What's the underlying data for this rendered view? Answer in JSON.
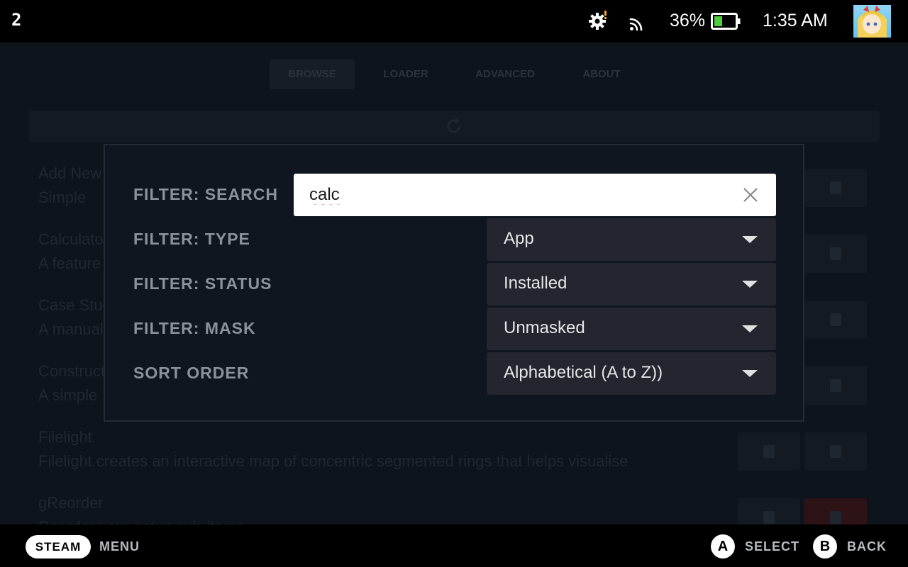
{
  "status_bar": {
    "left_indicator": "2",
    "battery_percent": "36%",
    "time": "1:35 AM",
    "icons": [
      "settings-alert-icon",
      "cast-icon",
      "battery-icon",
      "avatar"
    ]
  },
  "background": {
    "tabs": [
      "BROWSE",
      "LOADER",
      "ADVANCED",
      "ABOUT"
    ],
    "rows": [
      {
        "title": "Add New",
        "desc": "Simple"
      },
      {
        "title": "Calculator",
        "desc": "A feature"
      },
      {
        "title": "Case Study",
        "desc": "A manual"
      },
      {
        "title": "Construct",
        "desc": "A simple"
      },
      {
        "title": "Filelight",
        "desc": "Filelight creates an interactive map of concentric segmented rings that helps visualise"
      },
      {
        "title": "gReorder",
        "desc": "Reorder your setup sub-items"
      }
    ]
  },
  "filter_dialog": {
    "search": {
      "label": "FILTER: SEARCH",
      "value": "calc",
      "clear_icon": "close-icon"
    },
    "type": {
      "label": "FILTER: TYPE",
      "value": "App"
    },
    "status": {
      "label": "FILTER: STATUS",
      "value": "Installed"
    },
    "mask": {
      "label": "FILTER: MASK",
      "value": "Unmasked"
    },
    "sort": {
      "label": "SORT ORDER",
      "value": "Alphabetical (A to Z))"
    }
  },
  "footer": {
    "steam_label": "STEAM",
    "menu_label": "MENU",
    "select_key": "A",
    "select_label": "SELECT",
    "back_key": "B",
    "back_label": "BACK"
  },
  "colors": {
    "background": "#0e141b",
    "dialog": "#0f161f",
    "dropdown": "#23262e",
    "label": "#8b929a",
    "battery_fill": "#4ccf3b",
    "alert": "#f5a623"
  }
}
